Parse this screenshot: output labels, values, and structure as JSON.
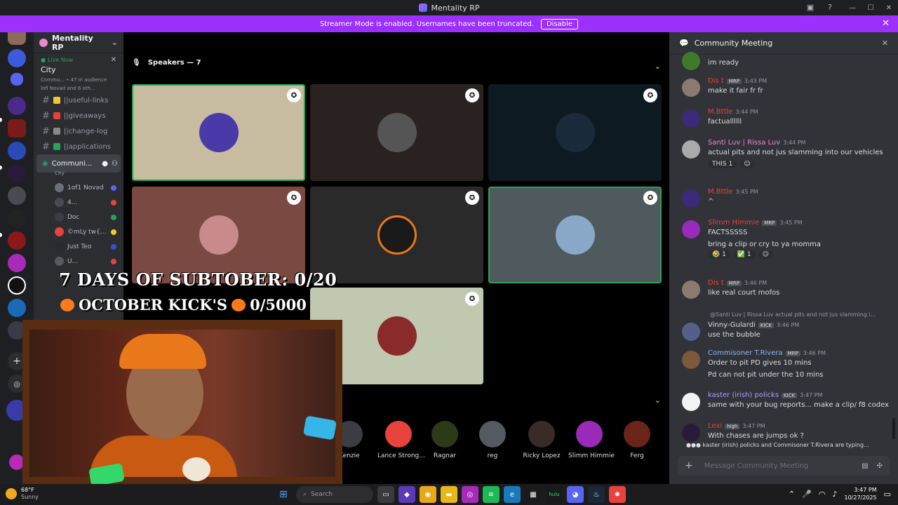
{
  "window": {
    "title": "Mentality RP"
  },
  "banner": {
    "text": "Streamer Mode is enabled. Usernames have been truncated.",
    "disable_label": "Disable"
  },
  "server": {
    "name": "Mentality RP",
    "live_label": "Live Now",
    "stage_name": "City",
    "stage_info": "Commu... • 47 in audience",
    "stage_members": "lofi Novad and 6 oth..."
  },
  "channels": [
    {
      "name": "||useful-links",
      "emoji_color": "#f5c531"
    },
    {
      "name": "||giveaways",
      "emoji_color": "#e8423c"
    },
    {
      "name": "||change-log",
      "emoji_color": "#8a8a8a"
    },
    {
      "name": "||applications",
      "emoji_color": "#23a55a"
    }
  ],
  "active_channel": {
    "name": "Communi...",
    "sub": "City"
  },
  "members": [
    {
      "name": "1of1 Novad",
      "color": "#6b6f78",
      "badge": "#5865f2"
    },
    {
      "name": "4...",
      "color": "#4a4a52",
      "badge": "#e8423c"
    },
    {
      "name": "Doc",
      "color": "#3c3c44",
      "badge": "#23a55a"
    },
    {
      "name": "©mLy tw{...",
      "color": "#e8423c",
      "badge": "#f5c531"
    },
    {
      "name": "Just Teo",
      "color": "#2a2a30",
      "badge": "#3e4bd8"
    },
    {
      "name": "U...",
      "color": "#565a60",
      "badge": "#e8423c"
    }
  ],
  "stage": {
    "speakers_label": "Speakers — 7"
  },
  "overlay": {
    "line1": "7 DAYS OF SUBTOBER: 0/20",
    "line2_a": "OCTOBER KICK'S",
    "line2_b": "0/5000"
  },
  "audience": [
    {
      "name": "Kenzie",
      "color": "#3c3c44"
    },
    {
      "name": "Lance Strong...",
      "color": "#e8423c"
    },
    {
      "name": "Ragnar",
      "color": "#2c3a18"
    },
    {
      "name": "reg",
      "color": "#555a62"
    },
    {
      "name": "Ricky Lopez",
      "color": "#3a2a28"
    },
    {
      "name": "Slimm Himmie",
      "color": "#9a2ab8"
    },
    {
      "name": "Ferg",
      "color": "#6a2418"
    }
  ],
  "chat": {
    "title": "Community Meeting",
    "messages": [
      {
        "author": "",
        "time": "",
        "text": "im ready",
        "author_color": "#dbdee1",
        "avatar": "#3f7a2a"
      },
      {
        "author": "Dis t",
        "tag": "MRP",
        "time": "3:43 PM",
        "text": "make it fair fr fr",
        "author_color": "#e8423c",
        "avatar": "#8a7a70"
      },
      {
        "author": "M.Bttle",
        "tag": "",
        "time": "3:44 PM",
        "text": "factuallllll",
        "author_color": "#e8423c",
        "avatar": "#3b2a78"
      },
      {
        "author": "Santi Luv | Rissa Luv",
        "tag": "",
        "time": "3:44 PM",
        "text": "actual pits and not jus slamming into our vehicles",
        "author_color": "#e88ad0",
        "avatar": "#aaa"
      },
      {
        "author": "M.Bttle",
        "tag": "",
        "time": "3:45 PM",
        "text": "^",
        "author_color": "#e8423c",
        "avatar": "#3b2a78"
      },
      {
        "author": "Slimm Himmie",
        "tag": "MRP",
        "time": "3:45 PM",
        "text": "FACTSSSSS",
        "text2": "bring a clip or cry to ya momma",
        "author_color": "#e8423c",
        "avatar": "#9a2ab8"
      },
      {
        "author": "Dis t",
        "tag": "MRP",
        "time": "3:46 PM",
        "text": "like real court mofos",
        "author_color": "#e8423c",
        "avatar": "#8a7a70"
      },
      {
        "author": "Vinny-Gulardi",
        "tag": "KICK",
        "time": "3:46 PM",
        "text": "use the bubble",
        "author_color": "#dbdee1",
        "avatar": "#55608a",
        "reply": "@Santi Luv | Rissa Luv actual pits and not jus slamming i..."
      },
      {
        "author": "Commisoner T.Rivera",
        "tag": "MRP",
        "time": "3:46 PM",
        "text": "Order to pit PD gives 10 mins",
        "text2": "Pd can not pit under the 10 mins",
        "author_color": "#8ab4f8",
        "avatar": "#7a5a3a"
      },
      {
        "author": "kaster (irish) policks",
        "tag": "KICK",
        "time": "3:47 PM",
        "text": "same with your bug reports... make a clip/ f8 codex",
        "author_color": "#a6a0ff",
        "avatar": "#f2f3f5"
      },
      {
        "author": "Lexi",
        "tag": "high",
        "time": "3:47 PM",
        "text": "With chases are jumps ok ?",
        "author_color": "#e8423c",
        "avatar": "#2a1a3a"
      }
    ],
    "reactions_santi": [
      "THIS 1"
    ],
    "reactions_slimm": [
      "🤣 1",
      "✅ 1"
    ],
    "typing": "kaster (irish) policks and Commisoner T.Rivera are typing...",
    "composer_placeholder": "Message Community Meeting"
  },
  "taskbar": {
    "temperature": "68°F",
    "weather": "Sunny",
    "search_placeholder": "Search",
    "time": "3:47 PM",
    "date": "10/27/2025"
  },
  "colors": {
    "accent_purple": "#9b30ff",
    "speaking_green": "#23a55a",
    "chat_bg": "#313338"
  }
}
